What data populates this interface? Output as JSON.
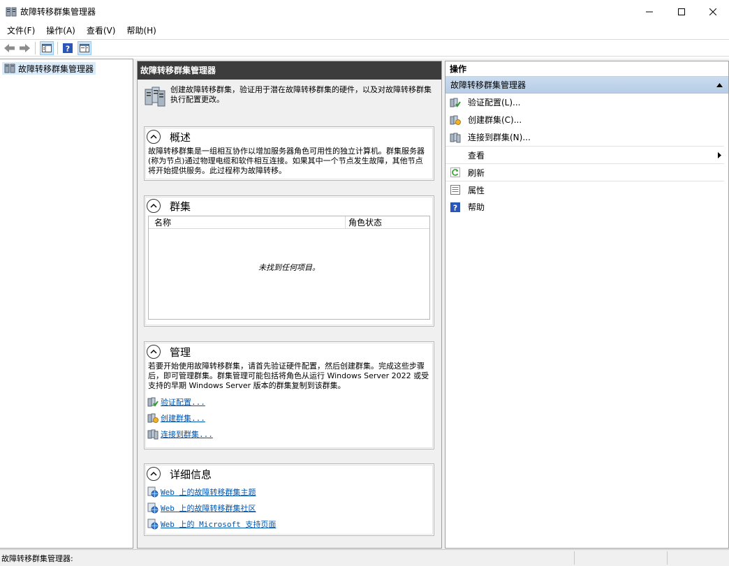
{
  "window": {
    "title": "故障转移群集管理器",
    "controls": [
      "minimize",
      "maximize",
      "close"
    ]
  },
  "menu": {
    "items": [
      "文件(F)",
      "操作(A)",
      "查看(V)",
      "帮助(H)"
    ]
  },
  "toolbar": {
    "buttons": [
      "back-icon",
      "forward-icon",
      "show-tree-icon",
      "help-icon",
      "show-action-pane-icon"
    ]
  },
  "tree": {
    "root_label": "故障转移群集管理器"
  },
  "center": {
    "header": "故障转移群集管理器",
    "intro": "创建故障转移群集，验证用于潜在故障转移群集的硬件，以及对故障转移群集执行配置更改。",
    "overview": {
      "title": "概述",
      "text": "故障转移群集是一组相互协作以增加服务器角色可用性的独立计算机。群集服务器(称为节点)通过物理电缆和软件相互连接。如果其中一个节点发生故障，其他节点将开始提供服务。此过程称为故障转移。"
    },
    "clusters": {
      "title": "群集",
      "col_name": "名称",
      "col_role_status": "角色状态",
      "empty_text": "未找到任何项目。"
    },
    "manage": {
      "title": "管理",
      "text": "若要开始使用故障转移群集，请首先验证硬件配置，然后创建群集。完成这些步骤后，即可管理群集。群集管理可能包括将角色从运行 Windows Server 2022 或受支持的早期 Windows Server 版本的群集复制到该群集。",
      "links": [
        "验证配置...",
        "创建群集...",
        "连接到群集..."
      ]
    },
    "details": {
      "title": "详细信息",
      "links": [
        "Web 上的故障转移群集主题",
        "Web 上的故障转移群集社区",
        "Web 上的 Microsoft 支持页面"
      ]
    }
  },
  "actions": {
    "title": "操作",
    "group": "故障转移群集管理器",
    "items": [
      "验证配置(L)...",
      "创建群集(C)...",
      "连接到群集(N)...",
      "查看",
      "刷新",
      "属性",
      "帮助"
    ]
  },
  "status": {
    "text": "故障转移群集管理器:"
  }
}
